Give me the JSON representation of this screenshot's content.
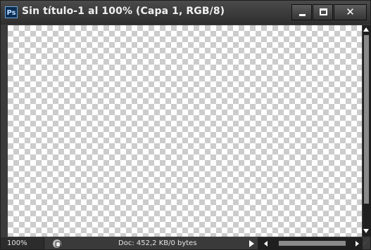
{
  "window": {
    "app_icon_text": "Ps",
    "title": "Sin título-1 al 100% (Capa 1, RGB/8)",
    "controls": {
      "minimize": "minimize",
      "maximize": "maximize",
      "close": "✕"
    }
  },
  "canvas": {
    "pattern": "transparency-checkerboard"
  },
  "status": {
    "zoom": "100%",
    "doc_info": "Doc: 452,2 KB/0 bytes"
  },
  "colors": {
    "chrome": "#3c3c3c",
    "titlebar": "#2e2e2e",
    "checker_dark": "#cccccc",
    "checker_light": "#ffffff"
  }
}
